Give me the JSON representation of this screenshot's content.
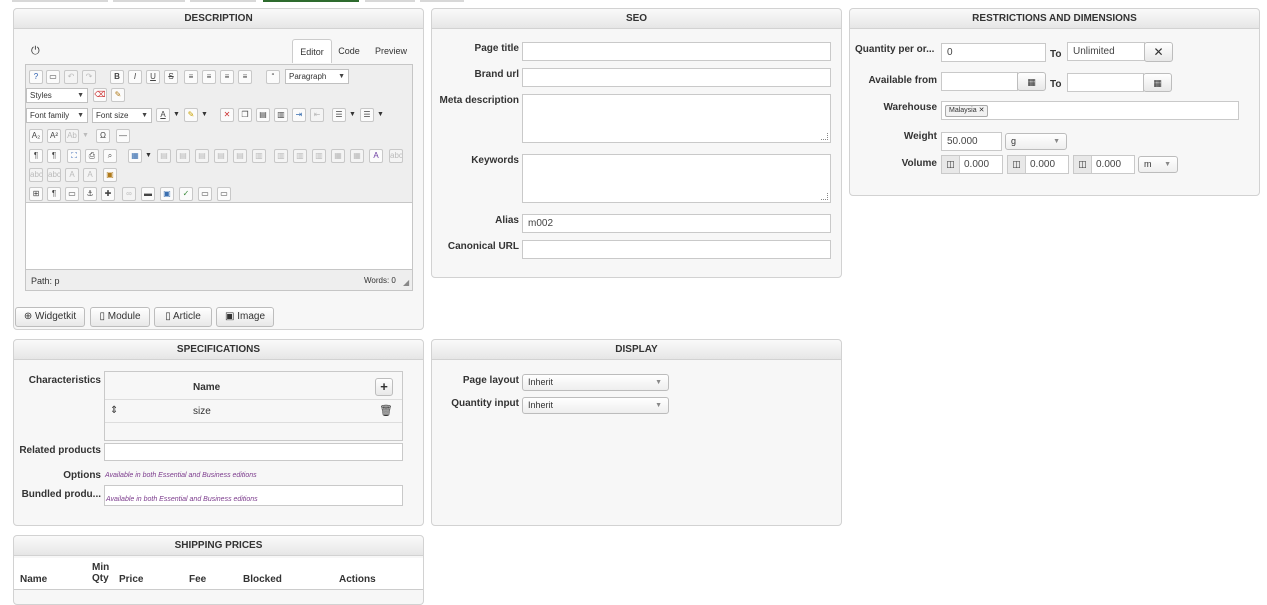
{
  "description": {
    "title": "DESCRIPTION",
    "tabs": [
      "Editor",
      "Code",
      "Preview"
    ],
    "format_select": "Paragraph",
    "styles_select": "Styles",
    "font_family_select": "Font family",
    "font_size_select": "Font size",
    "path_label": "Path: p",
    "words_label": "Words: 0",
    "buttons": {
      "widgetkit": "Widgetkit",
      "module": "Module",
      "article": "Article",
      "image": "Image"
    }
  },
  "seo": {
    "title": "SEO",
    "page_title_label": "Page title",
    "brand_url_label": "Brand url",
    "meta_description_label": "Meta description",
    "keywords_label": "Keywords",
    "alias_label": "Alias",
    "alias_value": "m002",
    "canonical_url_label": "Canonical URL"
  },
  "restrictions": {
    "title": "RESTRICTIONS AND DIMENSIONS",
    "quantity_label": "Quantity per or...",
    "quantity_from": "0",
    "to_label": "To",
    "quantity_to": "Unlimited",
    "available_from_label": "Available from",
    "warehouse_label": "Warehouse",
    "warehouse_chip": "Malaysia",
    "weight_label": "Weight",
    "weight_value": "50.000",
    "weight_unit": "g",
    "volume_label": "Volume",
    "volume_values": [
      "0.000",
      "0.000",
      "0.000"
    ],
    "volume_unit": "m"
  },
  "specifications": {
    "title": "SPECIFICATIONS",
    "characteristics_label": "Characteristics",
    "name_header": "Name",
    "row_value": "size",
    "related_products_label": "Related products",
    "options_label": "Options",
    "options_note": "Available in both Essential and Business editions",
    "bundled_label": "Bundled produ...",
    "bundled_note": "Available in both Essential and Business editions"
  },
  "display": {
    "title": "DISPLAY",
    "page_layout_label": "Page layout",
    "page_layout_value": "Inherit",
    "quantity_input_label": "Quantity input",
    "quantity_input_value": "Inherit"
  },
  "shipping": {
    "title": "SHIPPING PRICES",
    "headers": {
      "name": "Name",
      "min_qty": "Min\nQty",
      "price": "Price",
      "fee": "Fee",
      "blocked": "Blocked",
      "actions": "Actions"
    }
  },
  "colors": {
    "panel_bg": "#f7f7f7",
    "border": "#d2d2d2",
    "note": "#7b3a8c",
    "active_tab_strip": "#2e6b2e"
  }
}
